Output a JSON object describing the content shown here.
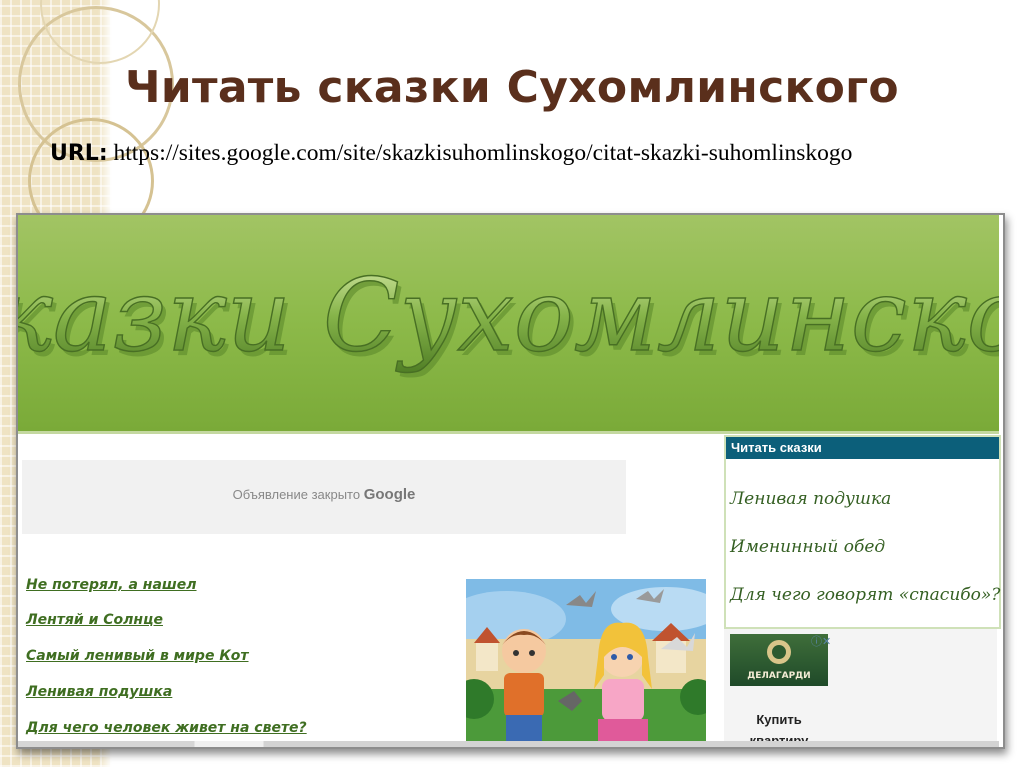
{
  "slide": {
    "title": "Читать сказки Сухомлинского",
    "url_label": "URL:",
    "url_value": "https://sites.google.com/site/skazkisuhomlinskogo/citat-skazki-suhomlinskogo"
  },
  "site": {
    "banner_title": "Сказки Сухомлинского",
    "ad": {
      "text": "Объявление закрыто",
      "brand": "Google"
    },
    "stories": [
      "Не потерял, а нашел",
      "Лентяй и Солнце",
      "Самый ленивый в мире Кот",
      "Ленивая подушка",
      "Для чего человек живет на свете?"
    ],
    "sidebar": {
      "heading": "Читать сказки",
      "links": [
        "Ленивая подушка",
        "Именинный обед",
        "Для чего говорят «спасибо»?"
      ]
    },
    "side_ad": {
      "close": "ⓘ✕",
      "logo_text": "ДЕЛАГАРДИ",
      "caption": "Купить квартиру"
    }
  },
  "colors": {
    "title": "#5a2f1c",
    "banner": "#8dba4a",
    "link": "#3f6e21",
    "sidebar_head": "#0c5f7a"
  },
  "icons": [
    "google-logo",
    "close-icon",
    "info-icon"
  ]
}
